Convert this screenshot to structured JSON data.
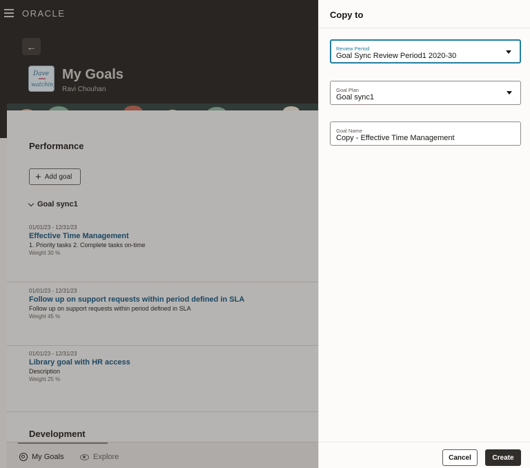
{
  "app": {
    "brand": "ORACLE",
    "back_icon": "arrow-left-icon",
    "menu_icon": "hamburger-icon"
  },
  "header": {
    "title": "My Goals",
    "subtitle": "Ravi Chouhan"
  },
  "performance": {
    "section_title": "Performance",
    "add_goal_label": "Add goal",
    "group_label": "Goal sync1",
    "goals": [
      {
        "dates": "01/01/23 - 12/31/23",
        "title": "Effective Time Management",
        "description": "1. Priority tasks 2. Complete tasks on-time",
        "weight": "Weight 30 %"
      },
      {
        "dates": "01/01/23 - 12/31/23",
        "title": "Follow up on support requests within period defined in SLA",
        "description": "Follow up on support requests within period defined in SLA",
        "weight": "Weight 45 %"
      },
      {
        "dates": "01/01/23 - 12/31/23",
        "title": "Library goal with HR access",
        "description": "Description",
        "weight": "Weight 25 %"
      }
    ]
  },
  "development": {
    "section_title": "Development"
  },
  "bottom_nav": {
    "items": [
      {
        "label": "My Goals",
        "icon": "target-icon"
      },
      {
        "label": "Explore",
        "icon": "eye-icon"
      }
    ]
  },
  "drawer": {
    "title": "Copy to",
    "fields": {
      "review_period": {
        "label": "Review Period",
        "value": "Goal Sync Review Period1 2020-30"
      },
      "goal_plan": {
        "label": "Goal Plan",
        "value": "Goal sync1"
      },
      "goal_name": {
        "label": "Goal Name",
        "value": "Copy - Effective Time Management"
      }
    },
    "cancel_label": "Cancel",
    "create_label": "Create"
  },
  "colors": {
    "accent": "#227e9e",
    "link": "#1f5c82",
    "header_bg": "#312d2a",
    "primary_button": "#312d2a"
  }
}
